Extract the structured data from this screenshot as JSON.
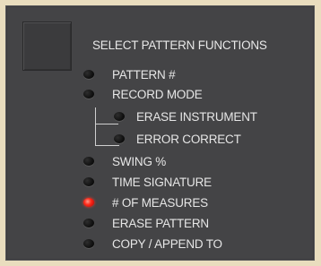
{
  "panel": {
    "title": "SELECT PATTERN FUNCTIONS"
  },
  "items": [
    {
      "label": "PATTERN #",
      "led_on": false
    },
    {
      "label": "RECORD MODE",
      "led_on": false
    },
    {
      "label": "ERASE INSTRUMENT",
      "led_on": false
    },
    {
      "label": "ERROR CORRECT",
      "led_on": false
    },
    {
      "label": "SWING %",
      "led_on": false
    },
    {
      "label": "TIME SIGNATURE",
      "led_on": false
    },
    {
      "label": "# OF MEASURES",
      "led_on": true
    },
    {
      "label": "ERASE PATTERN",
      "led_on": false
    },
    {
      "label": "COPY / APPEND TO",
      "led_on": false
    }
  ],
  "colors": {
    "panel_bg": "#444446",
    "page_bg": "#e9ddbe",
    "led_active": "#ff2a1a"
  }
}
